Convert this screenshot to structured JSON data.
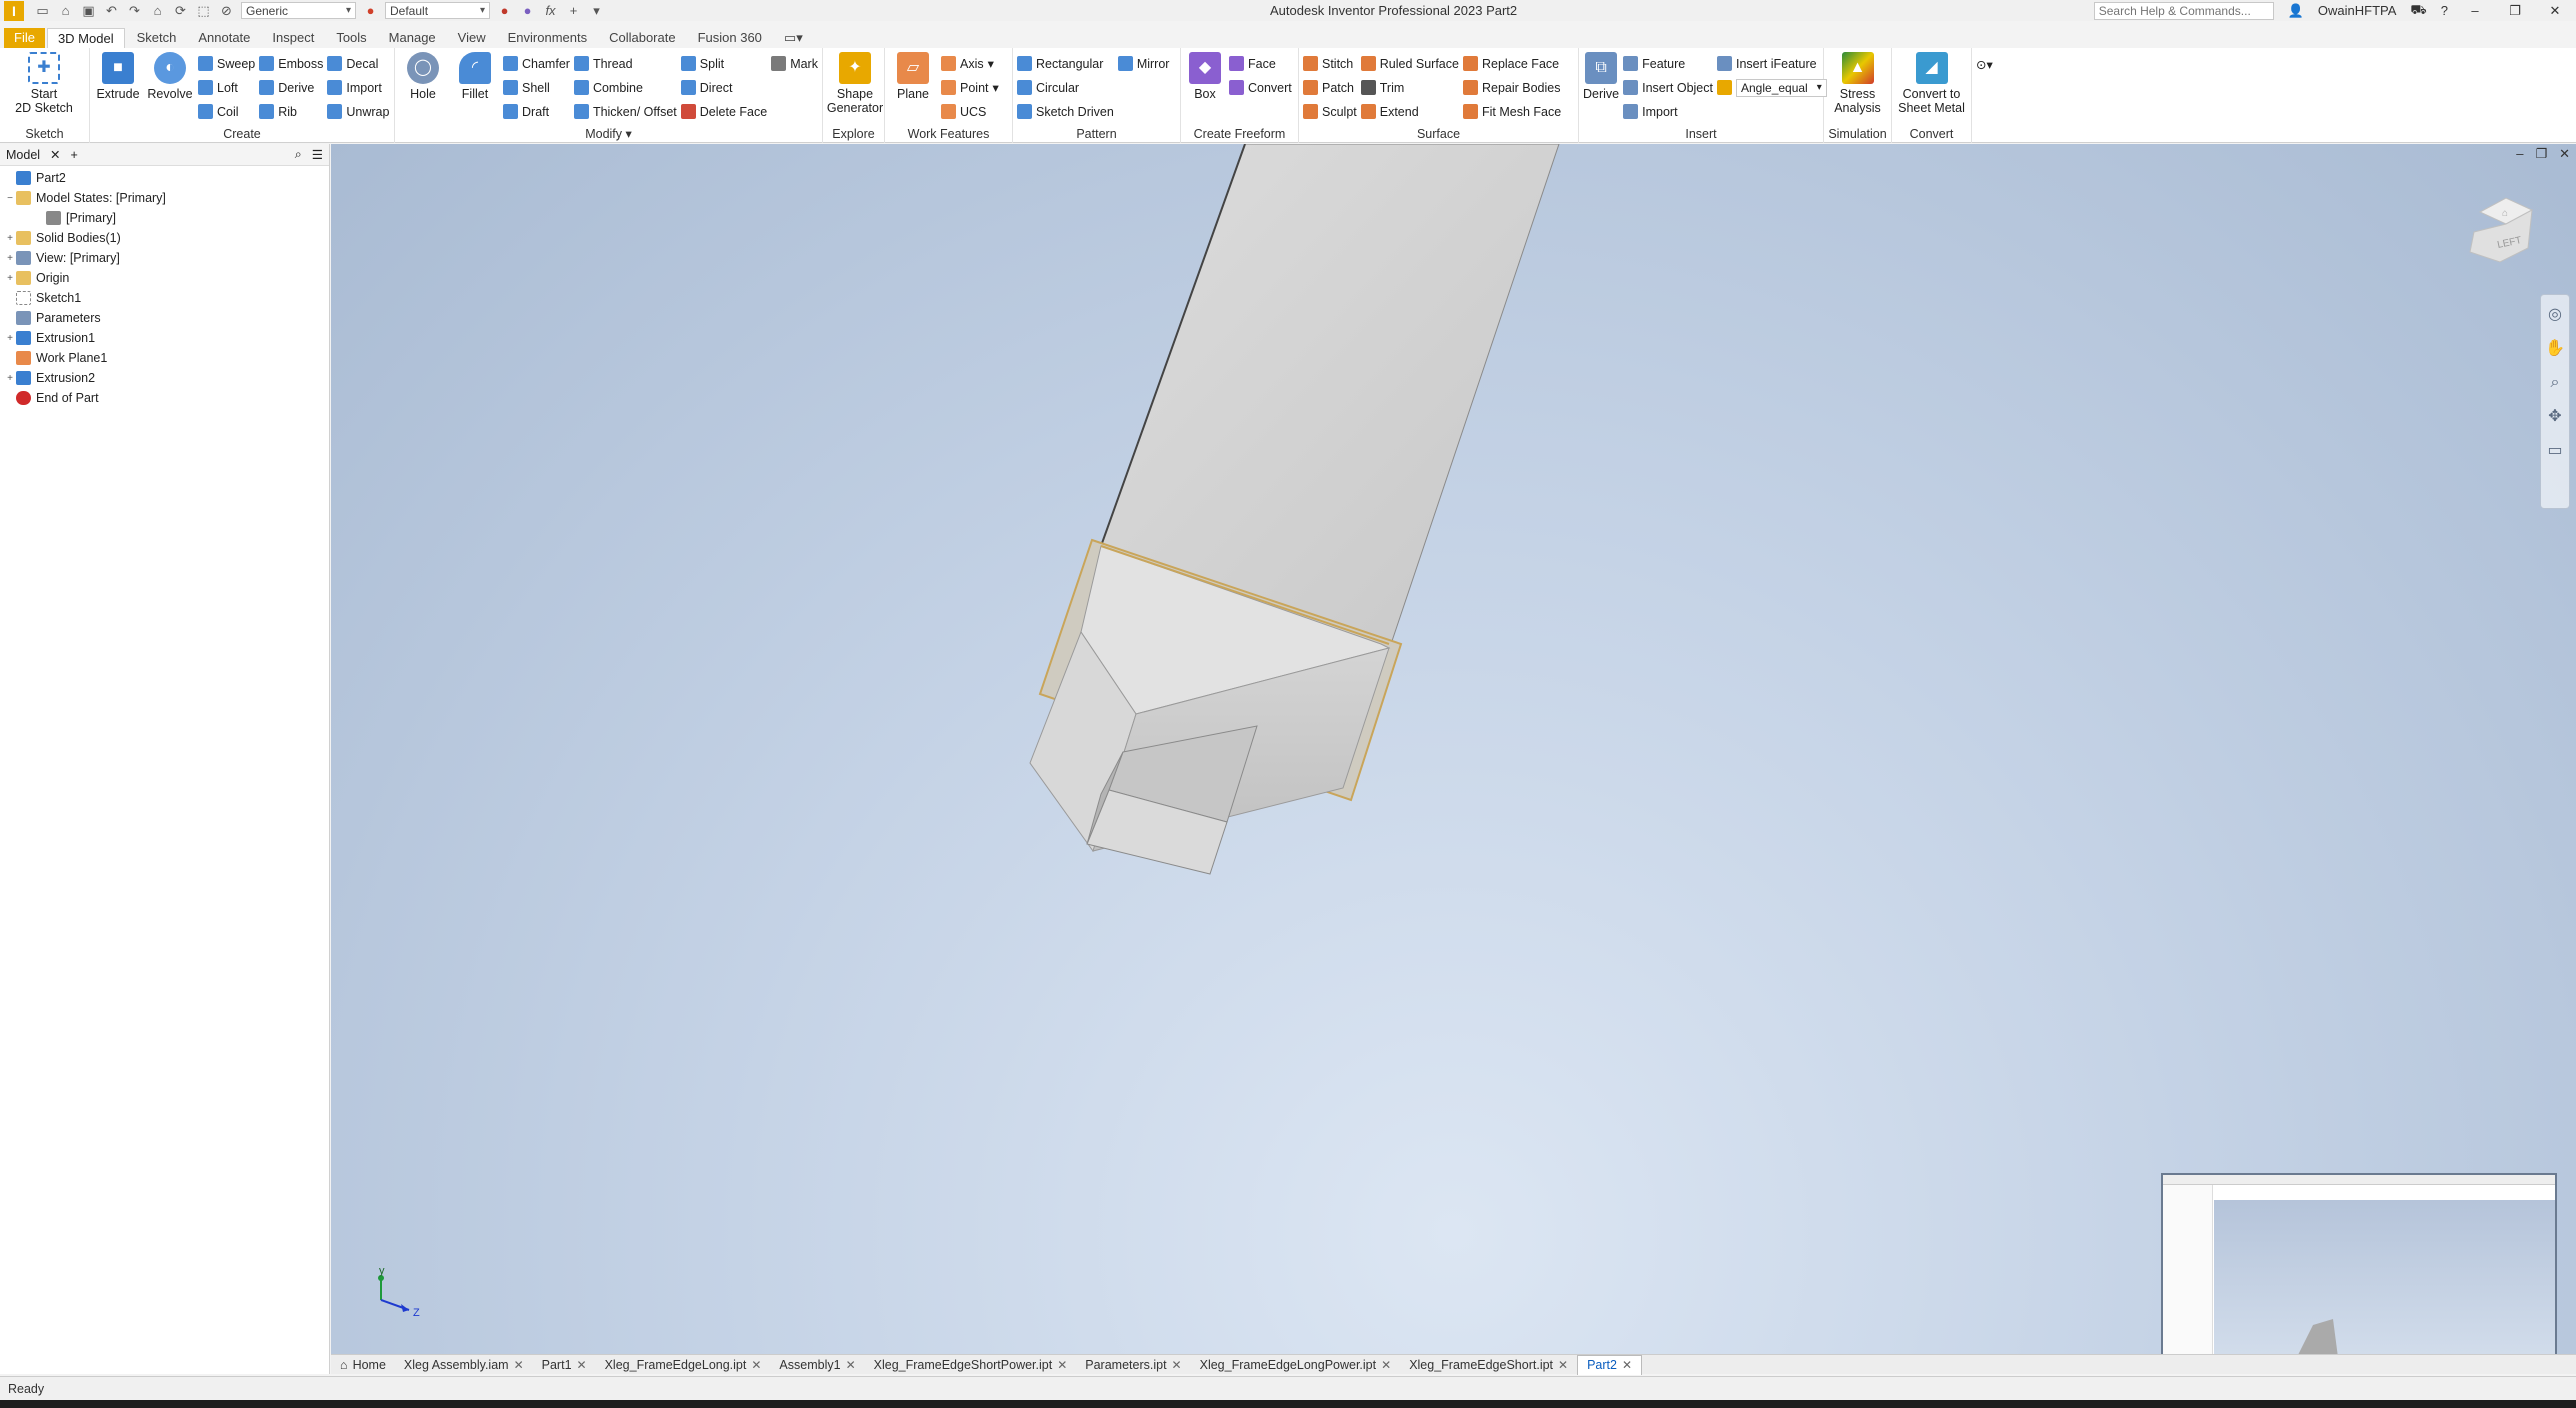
{
  "titlebar": {
    "title": "Autodesk Inventor Professional 2023    Part2",
    "appearance": "Generic",
    "material": "Default",
    "search_placeholder": "Search Help & Commands...",
    "user": "OwainHFTPA",
    "logo_letter": "I",
    "fx_label": "fx"
  },
  "tabs": [
    "File",
    "3D Model",
    "Sketch",
    "Annotate",
    "Inspect",
    "Tools",
    "Manage",
    "View",
    "Environments",
    "Collaborate",
    "Fusion 360"
  ],
  "ribbon": {
    "sketch": {
      "label": "Sketch",
      "start": "Start\n2D Sketch"
    },
    "create": {
      "label": "Create",
      "extrude": "Extrude",
      "revolve": "Revolve",
      "sweep": "Sweep",
      "loft": "Loft",
      "coil": "Coil",
      "emboss": "Emboss",
      "derive": "Derive",
      "rib": "Rib",
      "decal": "Decal",
      "import": "Import",
      "unwrap": "Unwrap"
    },
    "modify": {
      "label": "Modify",
      "hole": "Hole",
      "fillet": "Fillet",
      "chamfer": "Chamfer",
      "shell": "Shell",
      "draft": "Draft",
      "thread": "Thread",
      "combine": "Combine",
      "thicken": "Thicken/ Offset",
      "split": "Split",
      "direct": "Direct",
      "delete_face": "Delete Face",
      "mark": "Mark"
    },
    "explore": {
      "label": "Explore",
      "shape_generator": "Shape\nGenerator"
    },
    "work_features": {
      "label": "Work Features",
      "plane": "Plane",
      "axis": "Axis",
      "point": "Point",
      "ucs": "UCS"
    },
    "pattern": {
      "label": "Pattern",
      "rectangular": "Rectangular",
      "circular": "Circular",
      "sketch_driven": "Sketch Driven",
      "mirror": "Mirror"
    },
    "freeform": {
      "label": "Create Freeform",
      "box": "Box",
      "face": "Face",
      "convert": "Convert"
    },
    "surface": {
      "label": "Surface",
      "stitch": "Stitch",
      "patch": "Patch",
      "sculpt": "Sculpt",
      "ruled_surface": "Ruled Surface",
      "trim": "Trim",
      "extend": "Extend",
      "replace_face": "Replace Face",
      "repair_bodies": "Repair Bodies",
      "fit_mesh_face": "Fit Mesh Face"
    },
    "insert": {
      "label": "Insert",
      "derive": "Derive",
      "feature": "Feature",
      "insert_object": "Insert Object",
      "import": "Import",
      "insert_ifeature": "Insert iFeature",
      "angle_equal": "Angle_equal"
    },
    "simulation": {
      "label": "Simulation",
      "stress": "Stress\nAnalysis"
    },
    "convert": {
      "label": "Convert",
      "sheet_metal": "Convert to\nSheet Metal"
    }
  },
  "browser": {
    "tab": "Model",
    "items": [
      {
        "label": "Part2",
        "level": 0,
        "twisty": ""
      },
      {
        "label": "Model States: [Primary]",
        "level": 0,
        "twisty": "−"
      },
      {
        "label": "[Primary]",
        "level": 1,
        "twisty": ""
      },
      {
        "label": "Solid Bodies(1)",
        "level": 0,
        "twisty": "+"
      },
      {
        "label": "View: [Primary]",
        "level": 0,
        "twisty": "+"
      },
      {
        "label": "Origin",
        "level": 0,
        "twisty": "+"
      },
      {
        "label": "Sketch1",
        "level": 0,
        "twisty": ""
      },
      {
        "label": "Parameters",
        "level": 0,
        "twisty": ""
      },
      {
        "label": "Extrusion1",
        "level": 0,
        "twisty": "+"
      },
      {
        "label": "Work Plane1",
        "level": 0,
        "twisty": ""
      },
      {
        "label": "Extrusion2",
        "level": 0,
        "twisty": "+"
      },
      {
        "label": "End of Part",
        "level": 0,
        "twisty": ""
      }
    ]
  },
  "viewcube": {
    "face": "LEFT"
  },
  "axis": {
    "y": "y",
    "z": "Z"
  },
  "doc_tabs": [
    "Home",
    "Xleg Assembly.iam",
    "Part1",
    "Xleg_FrameEdgeLong.ipt",
    "Assembly1",
    "Xleg_FrameEdgeShortPower.ipt",
    "Parameters.ipt",
    "Xleg_FrameEdgeLongPower.ipt",
    "Xleg_FrameEdgeShort.ipt",
    "Part2"
  ],
  "status": "Ready",
  "colors": {
    "accent": "#e8a800",
    "active_tab": "#0a5dbf",
    "extrude": "#3a7fd0",
    "edge_highlight": "#c9a55a"
  }
}
